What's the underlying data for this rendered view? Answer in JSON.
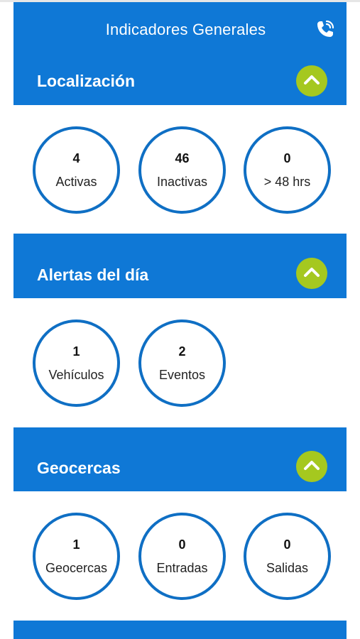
{
  "header": {
    "title": "Indicadores Generales",
    "phone_icon": "phone-call-icon",
    "background": "#0f78d6"
  },
  "sections": [
    {
      "title": "Localización",
      "toggle_icon": "chevron-up-icon",
      "indicators": [
        {
          "value": "4",
          "label": "Activas"
        },
        {
          "value": "46",
          "label": "Inactivas"
        },
        {
          "value": "0",
          "label": "> 48 hrs"
        }
      ]
    },
    {
      "title": "Alertas del día",
      "toggle_icon": "chevron-up-icon",
      "indicators": [
        {
          "value": "1",
          "label": "Vehículos"
        },
        {
          "value": "2",
          "label": "Eventos"
        }
      ]
    },
    {
      "title": "Geocercas",
      "toggle_icon": "chevron-up-icon",
      "indicators": [
        {
          "value": "1",
          "label": "Geocercas"
        },
        {
          "value": "0",
          "label": "Entradas"
        },
        {
          "value": "0",
          "label": "Salidas"
        }
      ]
    }
  ],
  "colors": {
    "primary": "#0f78d6",
    "accent": "#a5c81f",
    "circle_border": "#0f6fc4"
  }
}
